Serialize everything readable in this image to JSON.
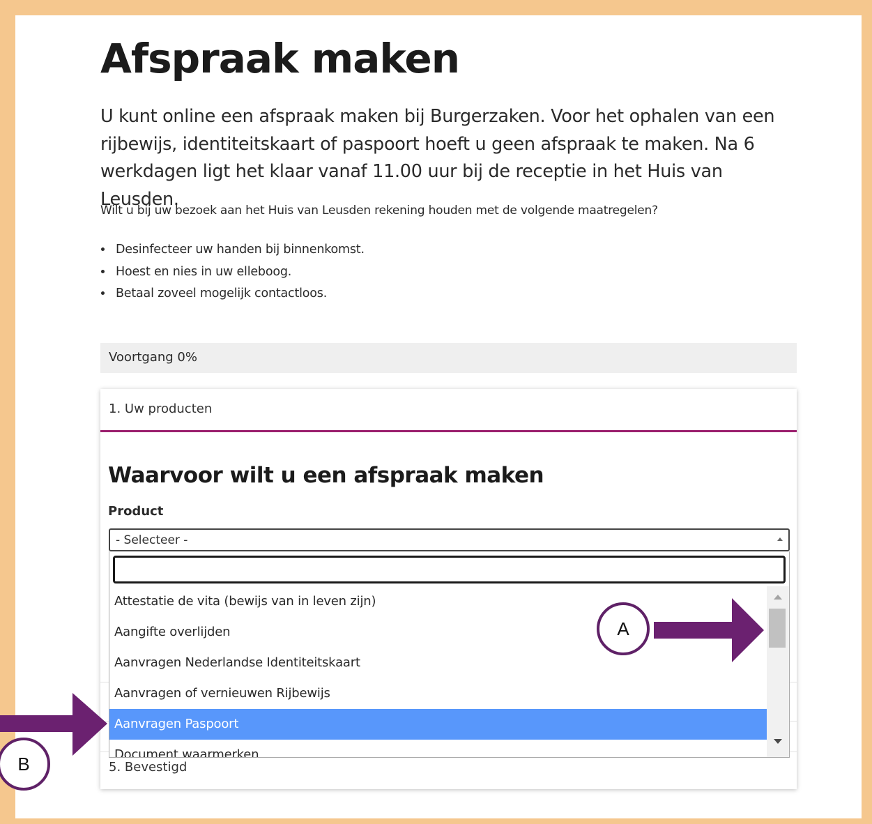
{
  "page": {
    "title": "Afspraak maken",
    "intro": "U kunt online een afspraak maken bij Burgerzaken. Voor het ophalen van een rijbewijs, identiteitskaart of paspoort hoeft u geen afspraak te maken. Na 6 werkdagen ligt het klaar vanaf 11.00 uur bij de receptie in het Huis van Leusden.",
    "note": "Wilt u bij uw bezoek aan het Huis van Leusden rekening houden met de volgende maatregelen?",
    "bullets": [
      "Desinfecteer uw handen bij binnenkomst.",
      "Hoest en nies in uw elleboog.",
      "Betaal zoveel mogelijk contactloos."
    ]
  },
  "progress": {
    "label": "Voortgang 0%",
    "value": 0
  },
  "form": {
    "step_label": "1. Uw producten",
    "title": "Waarvoor wilt u een afspraak maken",
    "field_label": "Product",
    "select_value": "- Selecteer -",
    "search_value": "",
    "options": [
      "Attestatie de vita (bewijs van in leven zijn)",
      "Aangifte overlijden",
      "Aanvragen Nederlandse Identiteitskaart",
      "Aanvragen of vernieuwen Rijbewijs",
      "Aanvragen Paspoort",
      "Document waarmerken"
    ],
    "selected_option": "Aanvragen Paspoort",
    "last_step_label": "5. Bevestigd"
  },
  "annotations": {
    "marker_a": "A",
    "marker_b": "B",
    "arrow_color": "#6b2170"
  },
  "colors": {
    "frame": "#f5c78e",
    "accent": "#9b1f6e",
    "highlight": "#5897fb"
  }
}
